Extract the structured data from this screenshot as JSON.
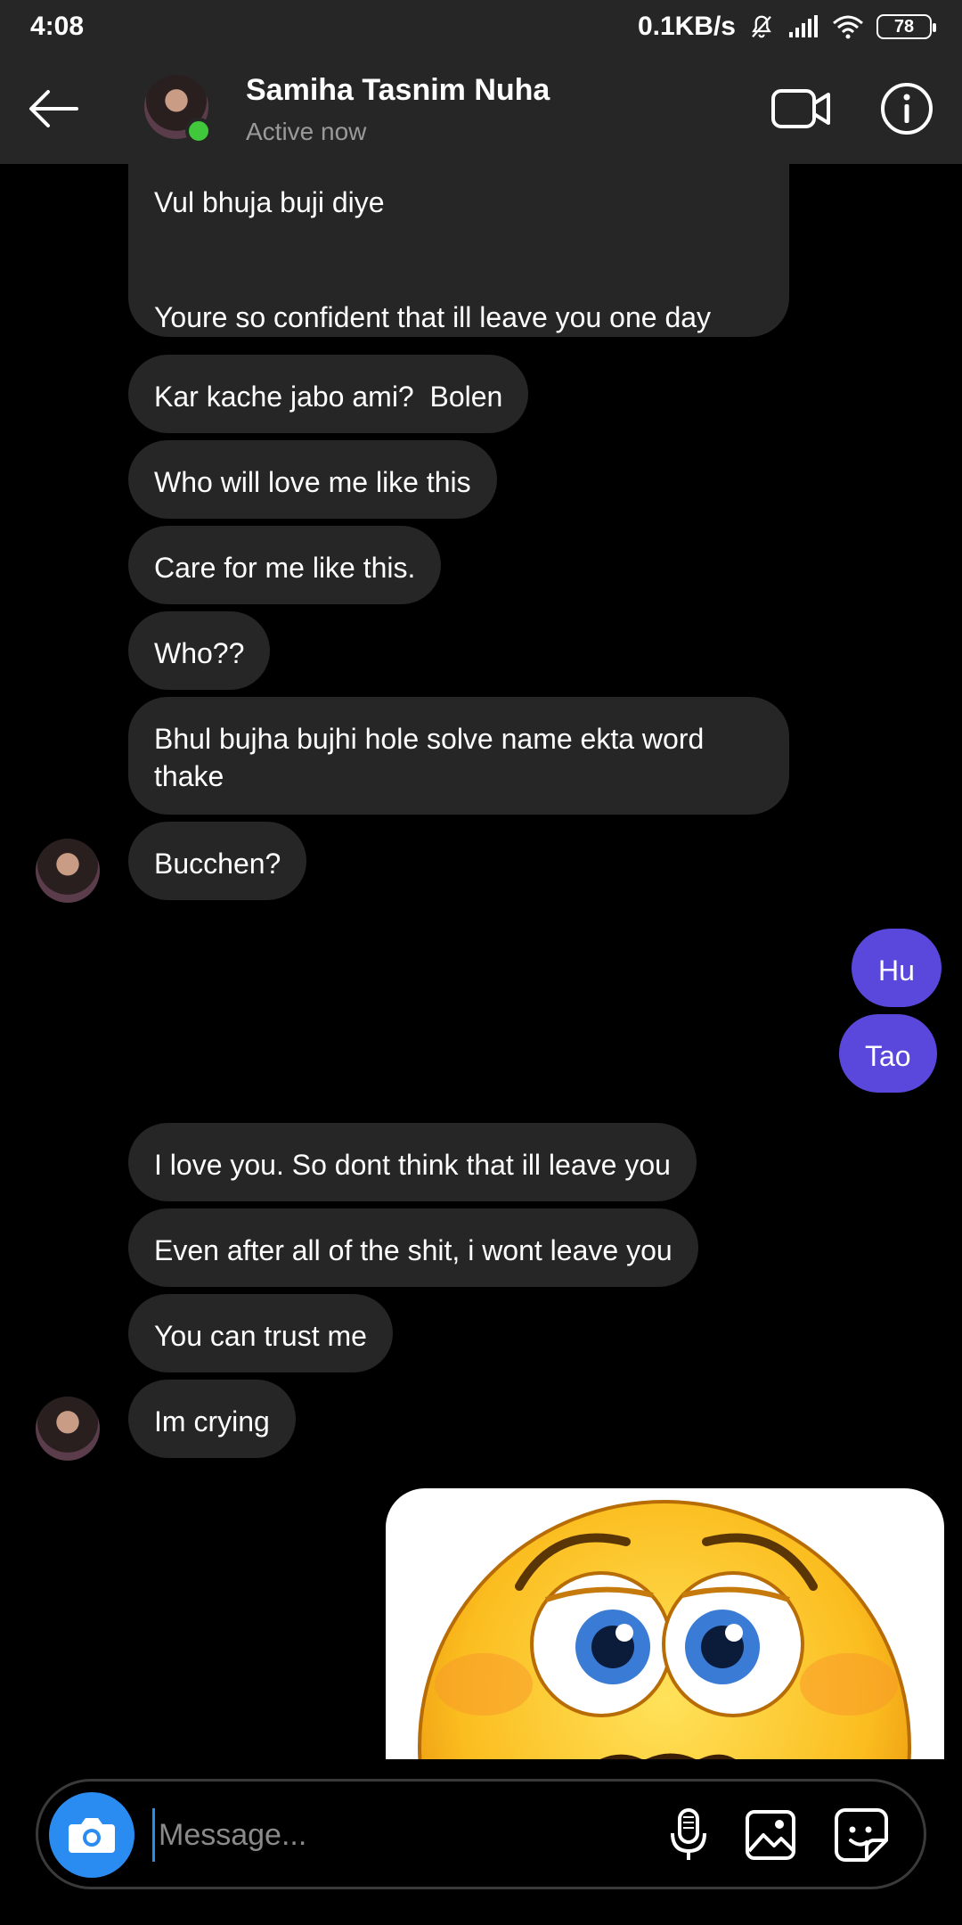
{
  "status_bar": {
    "time": "4:08",
    "network_speed": "0.1KB/s",
    "battery": "78",
    "icons": [
      "mute-icon",
      "signal-icon",
      "wifi-icon",
      "battery-icon"
    ]
  },
  "header": {
    "name": "Samiha Tasnim Nuha",
    "status": "Active now",
    "icons": [
      "back-arrow-icon",
      "video-call-icon",
      "info-icon"
    ]
  },
  "messages": [
    {
      "direction": "in",
      "text": "Vul bhuja buji diye\n\n\nYoure so confident that ill leave you one day"
    },
    {
      "direction": "in",
      "text": "Kar kache jabo ami?  Bolen"
    },
    {
      "direction": "in",
      "text": "Who will love me like this"
    },
    {
      "direction": "in",
      "text": "Care for me like this."
    },
    {
      "direction": "in",
      "text": "Who??"
    },
    {
      "direction": "in",
      "text": "Bhul bujha bujhi hole solve name ekta word thake"
    },
    {
      "direction": "in",
      "text": "Bucchen?"
    },
    {
      "direction": "out",
      "text": "Hu"
    },
    {
      "direction": "out",
      "text": "Tao"
    },
    {
      "direction": "in",
      "text": "I love you. So dont think that ill leave you"
    },
    {
      "direction": "in",
      "text": "Even after all of the shit, i wont leave you"
    },
    {
      "direction": "in",
      "text": "You can trust me"
    },
    {
      "direction": "in",
      "text": "Im crying"
    },
    {
      "direction": "out",
      "type": "sticker",
      "sticker": "worried-face-emoji"
    }
  ],
  "composer": {
    "placeholder": "Message...",
    "icons": [
      "camera-icon",
      "microphone-icon",
      "gallery-icon",
      "sticker-icon"
    ]
  },
  "colors": {
    "incoming_bubble": "#262626",
    "outgoing_bubble": "#5a48dc",
    "online": "#41c73b",
    "camera_button": "#2a8cf0"
  }
}
